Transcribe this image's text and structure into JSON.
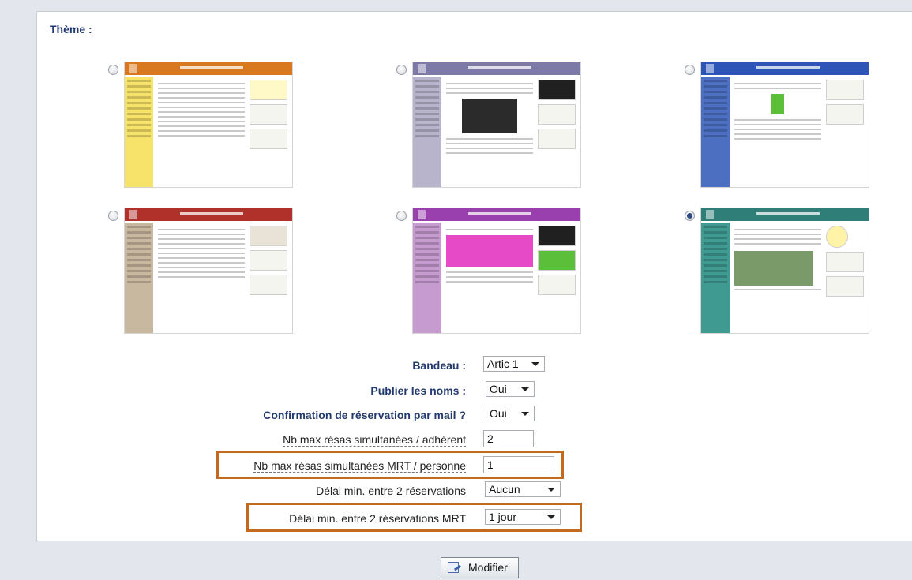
{
  "theme": {
    "label": "Thème :",
    "options": [
      {
        "name": "orange",
        "header_color": "#d9791f",
        "side_color": "#f7e36a",
        "selected": false
      },
      {
        "name": "purple-grey",
        "header_color": "#7e7aa8",
        "side_color": "#b7b4cc",
        "selected": false
      },
      {
        "name": "blue",
        "header_color": "#2f54b8",
        "side_color": "#4c6fc2",
        "selected": false
      },
      {
        "name": "red",
        "header_color": "#b0302a",
        "side_color": "#c9b8a0",
        "selected": false
      },
      {
        "name": "magenta",
        "header_color": "#9a3fae",
        "side_color": "#c59bd0",
        "selected": false
      },
      {
        "name": "teal",
        "header_color": "#2f7e78",
        "side_color": "#3f9a92",
        "selected": true
      }
    ]
  },
  "form": {
    "bandeau": {
      "label": "Bandeau :",
      "value": "Artic 1"
    },
    "publier_noms": {
      "label": "Publier les noms :",
      "value": "Oui"
    },
    "confirmation": {
      "label": "Confirmation de réservation par mail ?",
      "value": "Oui"
    },
    "nb_max_adherent": {
      "label": "Nb max résas simultanées / adhérent",
      "value": "2"
    },
    "nb_max_mrt": {
      "label": "Nb max résas simultanées MRT / personne",
      "value": "1"
    },
    "delai_min": {
      "label": "Délai min. entre 2 réservations",
      "value": "Aucun"
    },
    "delai_min_mrt": {
      "label": "Délai min. entre 2 réservations MRT",
      "value": "1 jour"
    }
  },
  "actions": {
    "modifier_label": "Modifier"
  },
  "colors": {
    "highlight": "#c46a1c",
    "label_blue": "#233a6e"
  }
}
